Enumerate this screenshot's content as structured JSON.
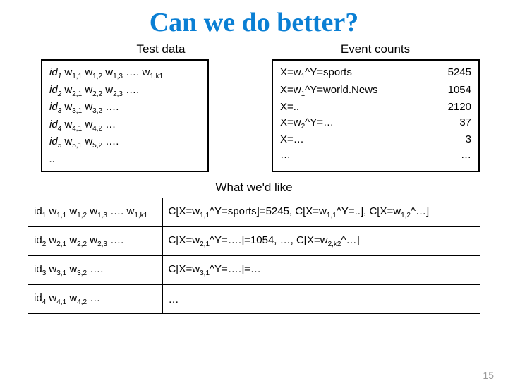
{
  "title": "Can we do better?",
  "headings": {
    "testdata": "Test data",
    "eventcounts": "Event counts",
    "whatwed": "What we'd like"
  },
  "testdata": [
    {
      "id": "id",
      "isub": "1",
      "words": " w<sub>1,1</sub> w<sub>1,2</sub> w<sub>1,3</sub> …. w<sub>1,k1</sub>"
    },
    {
      "id": "id",
      "isub": "2",
      "words": " w<sub>2,1</sub> w<sub>2,2</sub> w<sub>2,3</sub> …."
    },
    {
      "id": "id",
      "isub": "3",
      "words": " w<sub>3,1</sub> w<sub>3,2</sub> …."
    },
    {
      "id": "id",
      "isub": "4",
      "words": " w<sub>4,1</sub> w<sub>4,2</sub> …"
    },
    {
      "id": "id",
      "isub": "5",
      "words": " w<sub>5,1</sub> w<sub>5,2</sub> …."
    },
    {
      "id": "..",
      "isub": "",
      "words": ""
    }
  ],
  "eventcounts": [
    {
      "l": "X=w<sub>1</sub>^Y=sports",
      "r": "5245"
    },
    {
      "l": "X=w<sub>1</sub>^Y=world.News",
      "r": "1054"
    },
    {
      "l": "X=..",
      "r": "2120"
    },
    {
      "l": "X=w<sub>2</sub>^Y=…",
      "r": "37"
    },
    {
      "l": "X=…",
      "r": "3"
    },
    {
      "l": "…",
      "r": "…"
    }
  ],
  "liketable": [
    {
      "left": "id<sub>1</sub>  w<sub>1,1</sub> w<sub>1,2</sub> w<sub>1,3</sub> …. w<sub>1,k1</sub>",
      "right": "C[X=w<sub>1,1</sub>^Y=sports]=5245, C[X=w<sub>1,1</sub>^Y=..], C[X=w<sub>1,2</sub>^…]"
    },
    {
      "left": "id<sub>2</sub>  w<sub>2,1</sub> w<sub>2,2</sub> w<sub>2,3</sub> ….",
      "right": "C[X=w<sub>2,1</sub>^Y=….]=1054, …, C[X=w<sub>2,k2</sub>^…]"
    },
    {
      "left": "id<sub>3</sub>  w<sub>3,1</sub> w<sub>3,2</sub> ….",
      "right": "C[X=w<sub>3,1</sub>^Y=….]=…"
    },
    {
      "left": "id<sub>4</sub>  w<sub>4,1</sub> w<sub>4,2</sub> …",
      "right": "…"
    }
  ],
  "pagenum": "15"
}
